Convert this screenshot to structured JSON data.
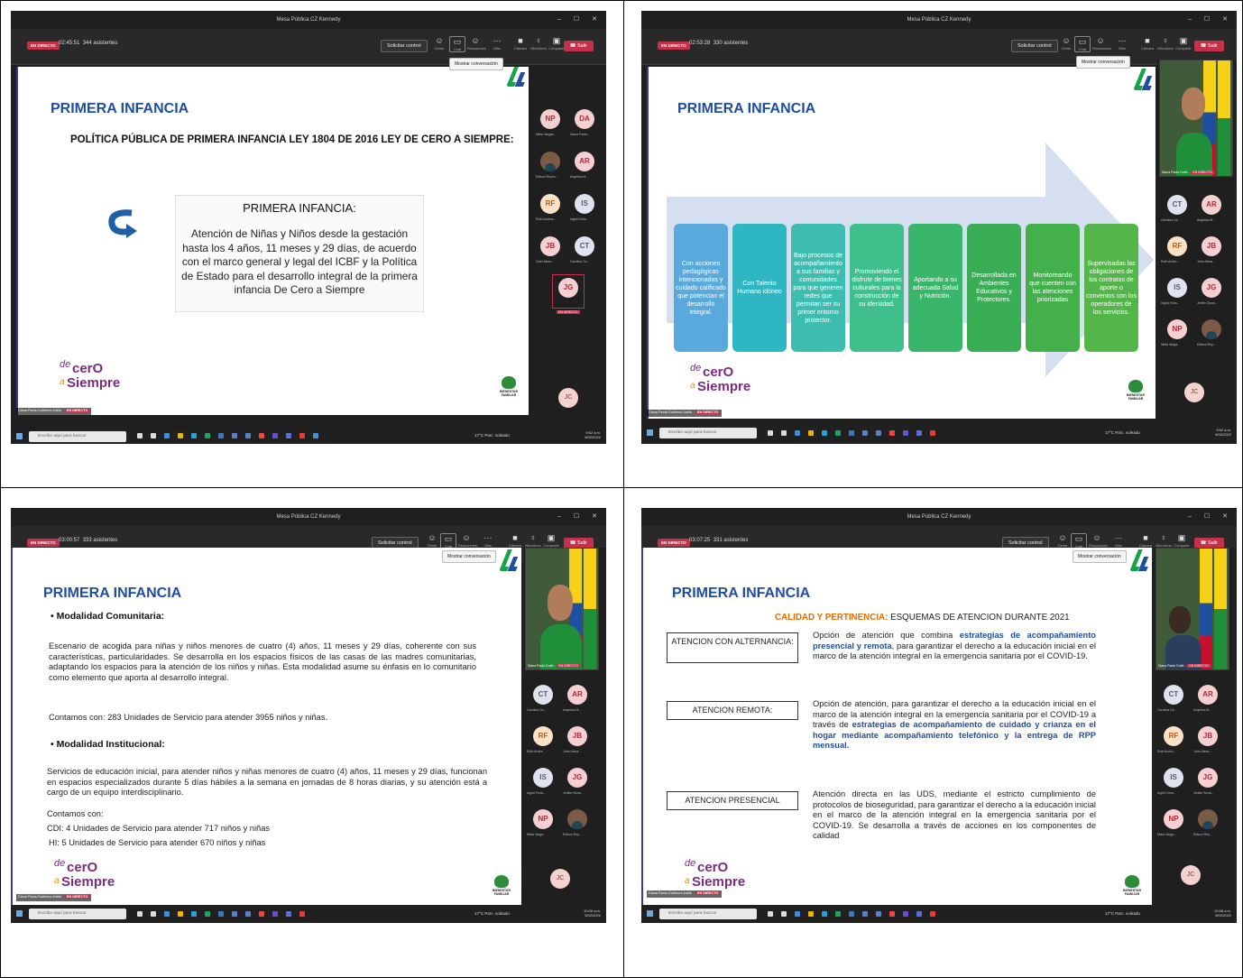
{
  "window_title": "Mesa Pública CZ Kennedy",
  "common": {
    "live_badge": "EN DIRECTO",
    "request_control": "Solicitar control",
    "leave": "Salir",
    "show_chat_tooltip": "Mostrar conversación",
    "toolbar_labels": [
      "Gente",
      "Chat",
      "Reacciones",
      "Más",
      "Cámara",
      "Micrófono",
      "Compartir"
    ],
    "search_placeholder": "Escribe aquí para buscar",
    "brand_logo": "de cero a Siempre",
    "bienestar_logo": "BIENESTAR FAMILIAR",
    "weather": "17°C Parc. soleado",
    "slide_title": "PRIMERA INFANCIA",
    "presenter_name": "Diana Paola Gutiérrez Ardila",
    "jc_initials": "JC"
  },
  "panels": [
    {
      "timer": "02:45:51",
      "participants": "344 asistentes",
      "clock_time": "9:52 a.m.",
      "clock_date": "5/02/2022",
      "subtitle": "POLÍTICA PÚBLICA DE PRIMERA INFANCIA LEY 1804 DE 2016 LEY DE CERO A SIEMPRE:",
      "box_title": "PRIMERA INFANCIA:",
      "box_text": "Atención de Niñas y Niños desde la gestación hasta los 4 años, 11 meses y 29 días, de acuerdo con el marco general y legal del ICBF y la Política de Estado para el desarrollo integral de la primera infancia De Cero a Siempre",
      "participants_list": [
        {
          "initials": "NP",
          "name": "Nidia Vargas..."
        },
        {
          "initials": "DA",
          "name": "Diana Paola..."
        },
        {
          "initials": "",
          "name": "Edison Reyes..."
        },
        {
          "initials": "AR",
          "name": "Angelica M..."
        },
        {
          "initials": "RF",
          "name": "Ruth Andrea..."
        },
        {
          "initials": "IS",
          "name": "Ingrid Yoha..."
        },
        {
          "initials": "JB",
          "name": "John Alexa..."
        },
        {
          "initials": "CT",
          "name": "Carolina Ca..."
        },
        {
          "initials": "JG",
          "name": "EN DIRECTO"
        }
      ]
    },
    {
      "timer": "02:53:28",
      "participants": "330 asistentes",
      "clock_time": "9:52 a.m.",
      "clock_date": "5/02/2022",
      "video_name": "Diana Paola Gutié...",
      "flow_steps": [
        "Con acciones pedagógicas intencionadas y cuidado calificado que potencian el desarrollo integral.",
        "Con Talento Humano idóneo",
        "Bajo procesos de acompañamiento a sus familias y comunidades para que generen redes que permitan ser su primer entorno protector.",
        "Promoviendo el disfrute de bienes culturales para la construcción de su identidad.",
        "Aportando a su adecuada Salud y Nutrición.",
        "Desarrollada en Ambientes Educativos y Protectores.",
        "Monitoreando que cuenten con las atenciones priorizadas",
        "Supervisadas las obligaciones de los contratos de aporte o convenios con los operadores de los servicios."
      ],
      "participants_list": [
        {
          "initials": "CT",
          "name": "Carolina Ca..."
        },
        {
          "initials": "AR",
          "name": "Angelica M..."
        },
        {
          "initials": "RF",
          "name": "Ruth Andre..."
        },
        {
          "initials": "JB",
          "name": "John Alexa..."
        },
        {
          "initials": "IS",
          "name": "Ingrid Yoha..."
        },
        {
          "initials": "JG",
          "name": "Jenifer Bona..."
        },
        {
          "initials": "NP",
          "name": "Nidia Varga..."
        },
        {
          "initials": "",
          "name": "Edison Rey..."
        }
      ]
    },
    {
      "timer": "03:00:57",
      "participants": "333 asistentes",
      "clock_time": "10:00 a.m.",
      "clock_date": "5/02/2022",
      "video_name": "Diana Paola Gutié...",
      "modalidad1_title": "• Modalidad Comunitaria:",
      "modalidad1_text": "Escenario de acogida para niñas y niños menores de cuatro (4) años, 11 meses y 29 días, coherente con sus características, particularidades. Se desarrolla en los espacios físicos de las casas de las madres comunitarias, adaptando los espacios para la atención de los niños y niñas. Esta modalidad asume su énfasis en lo comunitario como elemento que aporta al desarrollo integral.",
      "modalidad1_red": "Contamos con: 283 Unidades de Servicio para atender 3955 niños y niñas.",
      "modalidad2_title": "• Modalidad Institucional:",
      "modalidad2_text": "Servicios de educación inicial, para atender niños y niñas menores de cuatro (4) años, 11 meses y 29 días, funcionan en espacios especializados durante 5 días hábiles a la semana en jornadas de 8 horas diarias, y su atención está a cargo de un equipo interdisciplinario.",
      "modalidad2_red1": "Contamos con:",
      "modalidad2_red2": "CDI: 4 Unidades de Servicio para atender 717 niños y niñas",
      "modalidad2_red3": "HI: 5 Unidades de Servicio para atender 670 niños y niñas",
      "participants_list": [
        {
          "initials": "CT",
          "name": "Carolina Ca..."
        },
        {
          "initials": "AR",
          "name": "Angelica M..."
        },
        {
          "initials": "RF",
          "name": "Ruth Andre..."
        },
        {
          "initials": "JB",
          "name": "John Alexa..."
        },
        {
          "initials": "IS",
          "name": "Ingrid Yoha..."
        },
        {
          "initials": "JG",
          "name": "Jenifer Bona..."
        },
        {
          "initials": "NP",
          "name": "Nidia Varga..."
        },
        {
          "initials": "",
          "name": "Edison Rey..."
        }
      ]
    },
    {
      "timer": "03:07:25",
      "participants": "331 asistentes",
      "clock_time": "10:08 a.m.",
      "clock_date": "5/02/2022",
      "video_name": "Diana Paola Gutié...",
      "heading_red": "CALIDAD Y PERTINENCIA:",
      "heading_rest": " ESQUEMAS DE ATENCION DURANTE 2021",
      "rows": [
        {
          "label": "ATENCION CON ALTERNANCIA:",
          "pre": "Opción de atención que combina ",
          "bold": "estrategias de acompañamiento presencial y remota",
          "post": ", para garantizar el derecho a la educación inicial en el marco de la atención integral en la emergencia sanitaria por el COVID-19."
        },
        {
          "label": "ATENCION REMOTA:",
          "pre": "Opción de atención, para garantizar el derecho a la educación inicial en el marco de la atención integral en la emergencia sanitaria por el COVID-19 a través de ",
          "bold": "estrategias de acompañamiento de cuidado y crianza en el hogar mediante acompañamiento telefónico y la entrega de RPP mensual.",
          "post": ""
        },
        {
          "label": "ATENCION PRESENCIAL",
          "pre": "Atención directa en las UDS, mediante el estricto cumplimiento de protocolos de bioseguridad, para garantizar el derecho a la educación inicial en el marco de la atención integral en la emergencia sanitaria por el COVID-19. Se desarrolla a través de acciones en los componentes de calidad",
          "bold": "",
          "post": ""
        }
      ],
      "participants_list": [
        {
          "initials": "CT",
          "name": "Carolina Ca..."
        },
        {
          "initials": "AR",
          "name": "Angelica M..."
        },
        {
          "initials": "RF",
          "name": "Ruth Andre..."
        },
        {
          "initials": "JB",
          "name": "John Alexa..."
        },
        {
          "initials": "IS",
          "name": "Ingrid Yoha..."
        },
        {
          "initials": "JG",
          "name": "Jenifer Bona..."
        },
        {
          "initials": "NP",
          "name": "Nidia Varga..."
        },
        {
          "initials": "",
          "name": "Edison Rey..."
        }
      ]
    }
  ],
  "colors": {
    "title_blue": "#1f4e9e",
    "live_red": "#c4314b",
    "flow": [
      "#5aa9dc",
      "#2fb6c3",
      "#3dbdb0",
      "#3fbf8c",
      "#3ab66b",
      "#3aae55",
      "#43b04c",
      "#54b54a"
    ]
  }
}
